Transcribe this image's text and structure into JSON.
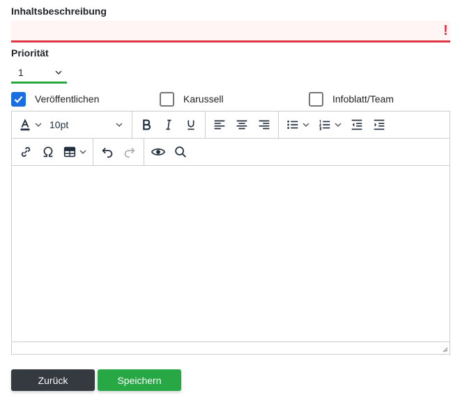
{
  "form": {
    "description_label": "Inhaltsbeschreibung",
    "description_value": "",
    "description_error_mark": "!",
    "priority_label": "Priorität",
    "priority_value": "1"
  },
  "checkboxes": [
    {
      "label": "Veröffentlichen",
      "checked": true
    },
    {
      "label": "Karussell",
      "checked": false
    },
    {
      "label": "Infoblatt/Team",
      "checked": false
    }
  ],
  "editor": {
    "font_size": "10pt",
    "toolbar_row1": [
      "text-color",
      "font-size",
      "bold",
      "italic",
      "underline",
      "align-left",
      "align-center",
      "align-right",
      "bullet-list",
      "numbered-list",
      "outdent",
      "indent"
    ],
    "toolbar_row2": [
      "link",
      "special-character",
      "table",
      "undo",
      "redo",
      "preview",
      "search"
    ],
    "content": ""
  },
  "buttons": {
    "back": "Zurück",
    "save": "Speichern"
  },
  "colors": {
    "error": "#dc3545",
    "success": "#28a745",
    "checkbox_accent": "#1a6fe0",
    "back_button": "#343a40"
  }
}
